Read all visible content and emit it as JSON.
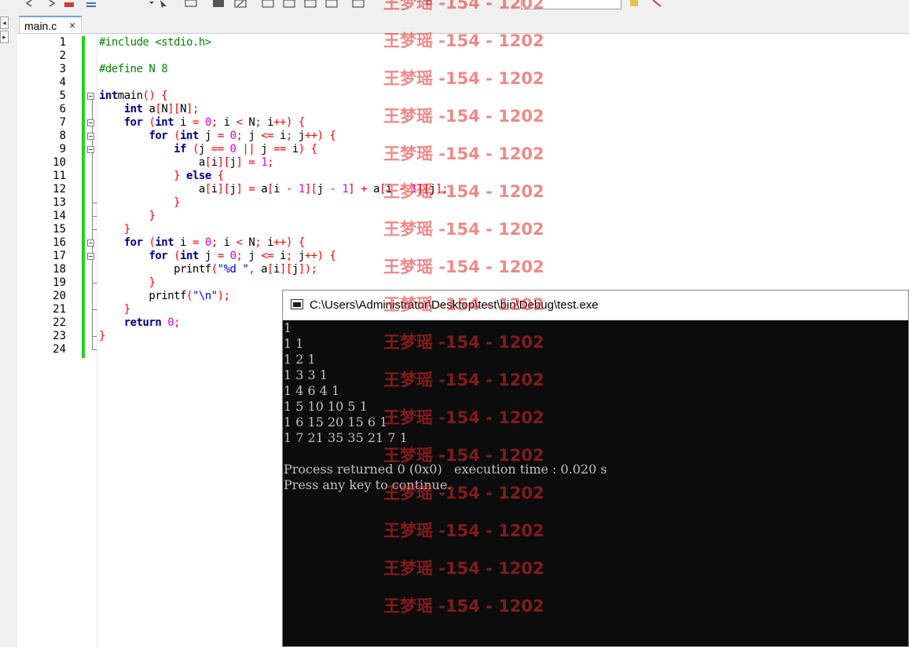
{
  "editor": {
    "tab_label": "main.c",
    "tab_close": "×",
    "lines": [
      {
        "n": "1",
        "t": [
          [
            "pp",
            "#include <stdio.h>"
          ]
        ]
      },
      {
        "n": "2",
        "t": []
      },
      {
        "n": "3",
        "t": [
          [
            "pp",
            "#define N 8"
          ]
        ]
      },
      {
        "n": "4",
        "t": []
      },
      {
        "n": "5",
        "t": [
          [
            "kw",
            "int"
          ],
          [
            "",
            "main"
          ],
          [
            "op",
            "()"
          ],
          [
            "",
            ""
          ],
          [
            "op",
            " {"
          ]
        ]
      },
      {
        "n": "6",
        "t": [
          [
            "",
            "    "
          ],
          [
            "kw",
            "int"
          ],
          [
            "",
            " a"
          ],
          [
            "op",
            "["
          ],
          [
            "",
            "N"
          ],
          [
            "op",
            "]["
          ],
          [
            "",
            "N"
          ],
          [
            "op",
            "];"
          ]
        ]
      },
      {
        "n": "7",
        "t": [
          [
            "",
            "    "
          ],
          [
            "kw",
            "for"
          ],
          [
            "op",
            " ("
          ],
          [
            "kw",
            "int"
          ],
          [
            "",
            " i "
          ],
          [
            "op",
            "="
          ],
          [
            "",
            " "
          ],
          [
            "num",
            "0"
          ],
          [
            "op",
            ";"
          ],
          [
            "",
            " i "
          ],
          [
            "op",
            "<"
          ],
          [
            "",
            " N"
          ],
          [
            "op",
            ";"
          ],
          [
            "",
            " i"
          ],
          [
            "op",
            "++)"
          ],
          [
            "",
            " "
          ],
          [
            "op",
            "{"
          ]
        ]
      },
      {
        "n": "8",
        "t": [
          [
            "",
            "        "
          ],
          [
            "kw",
            "for"
          ],
          [
            "op",
            " ("
          ],
          [
            "kw",
            "int"
          ],
          [
            "",
            " j "
          ],
          [
            "op",
            "="
          ],
          [
            "",
            " "
          ],
          [
            "num",
            "0"
          ],
          [
            "op",
            ";"
          ],
          [
            "",
            " j "
          ],
          [
            "op",
            "<="
          ],
          [
            "",
            " i"
          ],
          [
            "op",
            ";"
          ],
          [
            "",
            " j"
          ],
          [
            "op",
            "++)"
          ],
          [
            "",
            " "
          ],
          [
            "op",
            "{"
          ]
        ]
      },
      {
        "n": "9",
        "t": [
          [
            "",
            "            "
          ],
          [
            "kw",
            "if"
          ],
          [
            "op",
            " ("
          ],
          [
            "",
            "j "
          ],
          [
            "op",
            "=="
          ],
          [
            "",
            " "
          ],
          [
            "num",
            "0"
          ],
          [
            "",
            " "
          ],
          [
            "op",
            "||"
          ],
          [
            "",
            " j "
          ],
          [
            "op",
            "=="
          ],
          [
            "",
            " i"
          ],
          [
            "op",
            ")"
          ],
          [
            "",
            " "
          ],
          [
            "op",
            "{"
          ]
        ]
      },
      {
        "n": "10",
        "t": [
          [
            "",
            "                a"
          ],
          [
            "op",
            "["
          ],
          [
            "",
            "i"
          ],
          [
            "op",
            "]["
          ],
          [
            "",
            "j"
          ],
          [
            "op",
            "]"
          ],
          [
            "",
            " "
          ],
          [
            "op",
            "="
          ],
          [
            "",
            " "
          ],
          [
            "num",
            "1"
          ],
          [
            "op",
            ";"
          ]
        ]
      },
      {
        "n": "11",
        "t": [
          [
            "",
            "            "
          ],
          [
            "op",
            "}"
          ],
          [
            "",
            " "
          ],
          [
            "kw",
            "else"
          ],
          [
            "",
            " "
          ],
          [
            "op",
            "{"
          ]
        ]
      },
      {
        "n": "12",
        "t": [
          [
            "",
            "                a"
          ],
          [
            "op",
            "["
          ],
          [
            "",
            "i"
          ],
          [
            "op",
            "]["
          ],
          [
            "",
            "j"
          ],
          [
            "op",
            "]"
          ],
          [
            "",
            " "
          ],
          [
            "op",
            "="
          ],
          [
            "",
            " a"
          ],
          [
            "op",
            "["
          ],
          [
            "",
            "i "
          ],
          [
            "op",
            "-"
          ],
          [
            "",
            " "
          ],
          [
            "num",
            "1"
          ],
          [
            "op",
            "]["
          ],
          [
            "",
            "j "
          ],
          [
            "op",
            "-"
          ],
          [
            "",
            " "
          ],
          [
            "num",
            "1"
          ],
          [
            "op",
            "]"
          ],
          [
            "",
            " "
          ],
          [
            "op",
            "+"
          ],
          [
            "",
            " a"
          ],
          [
            "op",
            "["
          ],
          [
            "",
            "i "
          ],
          [
            "op",
            "-"
          ],
          [
            "",
            " "
          ],
          [
            "num",
            "1"
          ],
          [
            "op",
            "]["
          ],
          [
            "",
            "j"
          ],
          [
            "op",
            "];"
          ]
        ]
      },
      {
        "n": "13",
        "t": [
          [
            "",
            "            "
          ],
          [
            "op",
            "}"
          ]
        ]
      },
      {
        "n": "14",
        "t": [
          [
            "",
            "        "
          ],
          [
            "op",
            "}"
          ]
        ]
      },
      {
        "n": "15",
        "t": [
          [
            "",
            "    "
          ],
          [
            "op",
            "}"
          ]
        ]
      },
      {
        "n": "16",
        "t": [
          [
            "",
            "    "
          ],
          [
            "kw",
            "for"
          ],
          [
            "op",
            " ("
          ],
          [
            "kw",
            "int"
          ],
          [
            "",
            " i "
          ],
          [
            "op",
            "="
          ],
          [
            "",
            " "
          ],
          [
            "num",
            "0"
          ],
          [
            "op",
            ";"
          ],
          [
            "",
            " i "
          ],
          [
            "op",
            "<"
          ],
          [
            "",
            " N"
          ],
          [
            "op",
            ";"
          ],
          [
            "",
            " i"
          ],
          [
            "op",
            "++)"
          ],
          [
            "",
            " "
          ],
          [
            "op",
            "{"
          ]
        ]
      },
      {
        "n": "17",
        "t": [
          [
            "",
            "        "
          ],
          [
            "kw",
            "for"
          ],
          [
            "op",
            " ("
          ],
          [
            "kw",
            "int"
          ],
          [
            "",
            " j "
          ],
          [
            "op",
            "="
          ],
          [
            "",
            " "
          ],
          [
            "num",
            "0"
          ],
          [
            "op",
            ";"
          ],
          [
            "",
            " j "
          ],
          [
            "op",
            "<="
          ],
          [
            "",
            " i"
          ],
          [
            "op",
            ";"
          ],
          [
            "",
            " j"
          ],
          [
            "op",
            "++)"
          ],
          [
            "",
            " "
          ],
          [
            "op",
            "{"
          ]
        ]
      },
      {
        "n": "18",
        "t": [
          [
            "",
            "            printf"
          ],
          [
            "op",
            "("
          ],
          [
            "str",
            "\"%d \""
          ],
          [
            "op",
            ","
          ],
          [
            "",
            " a"
          ],
          [
            "op",
            "["
          ],
          [
            "",
            "i"
          ],
          [
            "op",
            "]["
          ],
          [
            "",
            "j"
          ],
          [
            "op",
            "]);"
          ]
        ]
      },
      {
        "n": "19",
        "t": [
          [
            "",
            "        "
          ],
          [
            "op",
            "}"
          ]
        ]
      },
      {
        "n": "20",
        "t": [
          [
            "",
            "        printf"
          ],
          [
            "op",
            "("
          ],
          [
            "str",
            "\"\\n\""
          ],
          [
            "op",
            ");"
          ]
        ]
      },
      {
        "n": "21",
        "t": [
          [
            "",
            "    "
          ],
          [
            "op",
            "}"
          ]
        ]
      },
      {
        "n": "22",
        "t": [
          [
            "",
            "    "
          ],
          [
            "kw",
            "return"
          ],
          [
            "",
            " "
          ],
          [
            "num",
            "0"
          ],
          [
            "op",
            ";"
          ]
        ]
      },
      {
        "n": "23",
        "t": [
          [
            "op",
            "}"
          ]
        ]
      },
      {
        "n": "24",
        "t": []
      }
    ]
  },
  "console": {
    "title": "C:\\Users\\Administrator\\Desktop\\test\\bin\\Debug\\test.exe",
    "lines": [
      "1",
      "1 1",
      "1 2 1",
      "1 3 3 1",
      "1 4 6 4 1",
      "1 5 10 10 5 1",
      "1 6 15 20 15 6 1",
      "1 7 21 35 35 21 7 1",
      "",
      "Process returned 0 (0x0)   execution time : 0.020 s",
      "Press any key to continue."
    ]
  },
  "watermark": {
    "text": "王梦瑶 -154 - 1202",
    "count": 17
  },
  "colors": {
    "keyword": "#00008b",
    "preprocessor": "#008a00",
    "number": "#e000e0",
    "string": "#0000ff",
    "operator": "#ff0000",
    "change_bar": "#1ed41e",
    "console_bg": "#0c0c0c",
    "console_text": "#c0c0c0"
  }
}
